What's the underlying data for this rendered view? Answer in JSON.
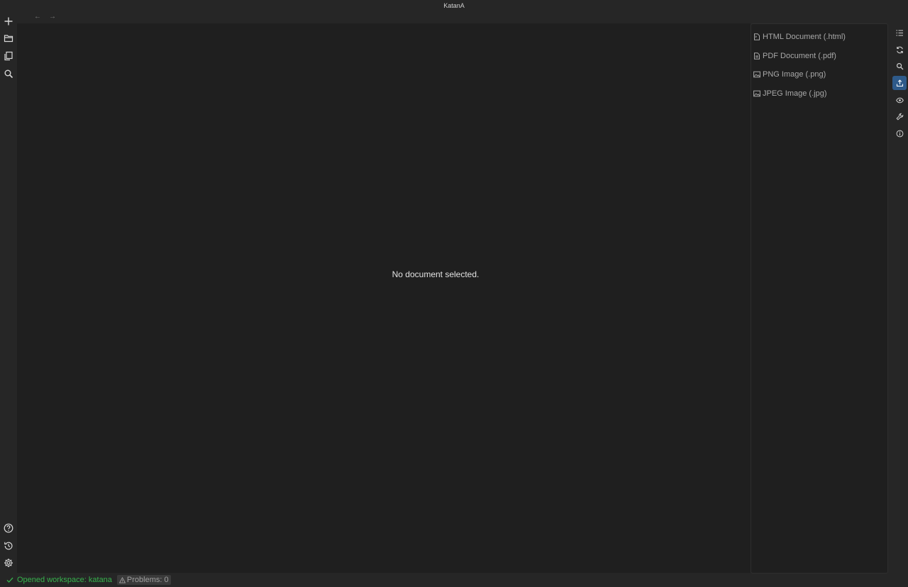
{
  "window": {
    "title": "KatanA"
  },
  "nav": {
    "back_label": "←",
    "forward_label": "→"
  },
  "leftbar": {
    "top_icons": [
      "plus-icon",
      "folder-open-icon",
      "copy-icon",
      "search-icon"
    ],
    "bottom_icons": [
      "help-icon",
      "history-icon",
      "settings-icon"
    ]
  },
  "editor": {
    "empty_message": "No document selected."
  },
  "export_panel": {
    "items": [
      {
        "label": "HTML Document (.html)",
        "icon": "html-file-icon"
      },
      {
        "label": "PDF Document (.pdf)",
        "icon": "pdf-file-icon"
      },
      {
        "label": "PNG Image (.png)",
        "icon": "image-icon"
      },
      {
        "label": "JPEG Image (.jpg)",
        "icon": "image-icon"
      }
    ]
  },
  "rightbar": {
    "icons": [
      "list-icon",
      "refresh-icon",
      "search-icon",
      "export-icon",
      "eye-icon",
      "wrench-icon",
      "info-icon"
    ],
    "active": "export-icon",
    "active_color": "#2e5a8a"
  },
  "status": {
    "message": "Opened workspace: katana",
    "message_color": "#37b24d",
    "problems_label": "Problems: 0"
  }
}
